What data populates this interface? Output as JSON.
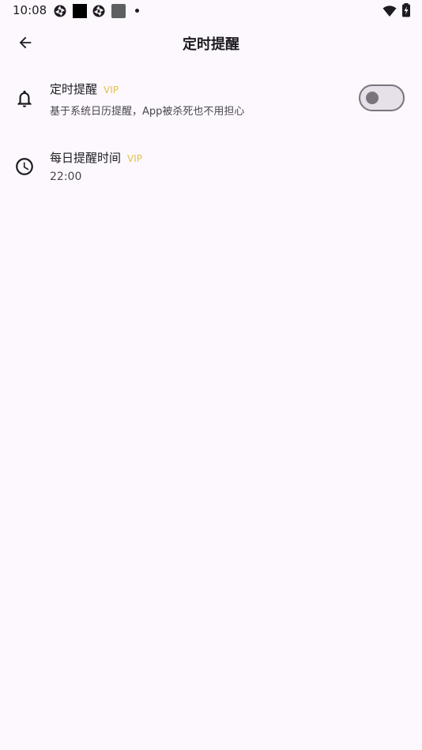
{
  "status_bar": {
    "time": "10:08"
  },
  "app_bar": {
    "title": "定时提醒",
    "back_icon": "arrow-left-icon"
  },
  "settings": [
    {
      "icon": "bell-icon",
      "title": "定时提醒",
      "badge": "VIP",
      "subtitle": "基于系统日历提醒，App被杀死也不用担心",
      "toggle_on": false
    },
    {
      "icon": "clock-icon",
      "title": "每日提醒时间",
      "badge": "VIP",
      "subtitle": "22:00"
    }
  ],
  "colors": {
    "background": "#fcf8fd",
    "vip": "#e6c14a",
    "text_primary": "#1d1b20",
    "text_secondary": "#49454f",
    "switch_outline": "#79747e"
  }
}
